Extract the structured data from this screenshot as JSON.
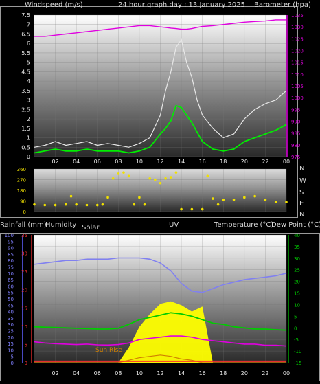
{
  "header": {
    "windspeed_label": "Windspeed (m/s)",
    "title": "24 hour graph day : 13 January 2025",
    "barometer_label": "Barometer (hpa)"
  },
  "legend_row": {
    "rainfall": "Rainfall (mm)",
    "humidity": "Humidity",
    "solar": "Solar",
    "uv": "UV",
    "temperature": "Temperature (°C)",
    "dew_point": "Dew Point (°C)"
  },
  "direction_labels": [
    "N",
    "W",
    "S",
    "E",
    "N"
  ],
  "sunrise_label": "Sun Rise",
  "colors": {
    "wind_gust": "#e8e8e8",
    "wind_avg": "#00ee00",
    "barometer": "#e000e0",
    "direction": "#f0e000",
    "humidity": "#8080f0",
    "temperature": "#00cc00",
    "dew_point": "#e000e0",
    "solar": "#ffff00",
    "uv": "#d08000",
    "rain": "#ff3030",
    "left_axis_humidity": "#6060ff",
    "right_axis_temp": "#00cc00"
  },
  "chart_data": [
    {
      "type": "line",
      "title": "24 hour graph day : 13 January 2025",
      "x_tick_labels": [
        "02",
        "04",
        "06",
        "08",
        "10",
        "12",
        "14",
        "16",
        "18",
        "20",
        "22",
        "00"
      ],
      "xlabel": "",
      "ylabel": "Windspeed (m/s)",
      "ylim": [
        0,
        7.5
      ],
      "y_ticks": [
        "0",
        "0.5",
        "1",
        "1.5",
        "2",
        "2.5",
        "3",
        "3.5",
        "4",
        "4.5",
        "5",
        "5.5",
        "6",
        "6.5",
        "7",
        "7.5"
      ],
      "y2label": "Barometer (hpa)",
      "y2lim": [
        975,
        1035
      ],
      "y2_ticks": [
        "975",
        "980",
        "985",
        "990",
        "995",
        "1000",
        "1005",
        "1010",
        "1015",
        "1020",
        "1025",
        "1030",
        "1035"
      ],
      "x_hours": [
        0,
        1,
        2,
        3,
        4,
        5,
        6,
        7,
        8,
        9,
        10,
        11,
        12,
        12.5,
        13,
        13.5,
        14,
        14.5,
        15,
        15.5,
        16,
        17,
        18,
        19,
        20,
        21,
        22,
        23,
        24
      ],
      "series": [
        {
          "values": [
            0.5,
            0.6,
            0.8,
            0.6,
            0.7,
            0.8,
            0.6,
            0.7,
            0.6,
            0.5,
            0.7,
            1.0,
            2.2,
            3.5,
            4.5,
            5.8,
            6.2,
            5.0,
            4.2,
            3.0,
            2.2,
            1.5,
            1.0,
            1.2,
            2.0,
            2.5,
            2.8,
            3.0,
            3.5
          ]
        },
        {
          "values": [
            0.2,
            0.3,
            0.4,
            0.3,
            0.3,
            0.4,
            0.3,
            0.3,
            0.3,
            0.2,
            0.3,
            0.5,
            1.2,
            1.5,
            1.9,
            2.7,
            2.6,
            2.2,
            1.8,
            1.3,
            0.8,
            0.4,
            0.3,
            0.4,
            0.8,
            1.0,
            1.2,
            1.4,
            1.7
          ]
        },
        {
          "axis": "y2",
          "values": [
            1026,
            1026,
            1026.5,
            1027,
            1027.5,
            1028,
            1028.5,
            1029,
            1029.5,
            1030,
            1030.5,
            1030.5,
            1030,
            1029.8,
            1029.5,
            1029.3,
            1029,
            1029,
            1029.3,
            1029.8,
            1030.2,
            1030.5,
            1031,
            1031.5,
            1032,
            1032.3,
            1032.5,
            1033,
            1033
          ]
        }
      ]
    },
    {
      "type": "scatter",
      "ylabel": "",
      "ylim": [
        0,
        360
      ],
      "y_ticks": [
        "0",
        "90",
        "180",
        "270",
        "360"
      ],
      "x_tick_labels": [],
      "x_hours": [
        0,
        1,
        2,
        3,
        3.5,
        4,
        5,
        6,
        6.5,
        7,
        7.5,
        8,
        8.5,
        9,
        9.5,
        10,
        10.5,
        11,
        11.5,
        12,
        12.5,
        13,
        13.5,
        14,
        15,
        16,
        16.5,
        17,
        17.5,
        18,
        19,
        20,
        21,
        22,
        23,
        24
      ],
      "series": [
        {
          "values": [
            60,
            55,
            55,
            60,
            130,
            60,
            55,
            55,
            60,
            120,
            280,
            320,
            330,
            300,
            60,
            120,
            60,
            280,
            270,
            240,
            280,
            290,
            330,
            20,
            20,
            20,
            300,
            110,
            60,
            100,
            100,
            120,
            130,
            100,
            80,
            80
          ]
        }
      ]
    },
    {
      "type": "line",
      "ylabel": "Humidity",
      "ylim": [
        0,
        100
      ],
      "y_ticks": [
        "0",
        "5",
        "10",
        "15",
        "20",
        "25",
        "30",
        "35",
        "40",
        "45",
        "50",
        "55",
        "60",
        "65",
        "70",
        "75",
        "80",
        "85",
        "90",
        "95",
        "100"
      ],
      "y_ticks_rain": [
        "0",
        "5",
        "10",
        "15",
        "20",
        "25",
        "30",
        "35"
      ],
      "y2label": "Temperature (°C)",
      "y2lim": [
        -15,
        40
      ],
      "y2_ticks": [
        "-15",
        "-10",
        "-5",
        "0",
        "5",
        "10",
        "15",
        "20",
        "25",
        "30",
        "35",
        "40"
      ],
      "x_tick_labels": [
        "02",
        "04",
        "06",
        "08",
        "10",
        "12",
        "14",
        "16",
        "18",
        "20",
        "22",
        "00"
      ],
      "x_hours": [
        0,
        1,
        2,
        3,
        4,
        5,
        6,
        7,
        8,
        9,
        10,
        11,
        12,
        13,
        14,
        15,
        16,
        17,
        18,
        19,
        20,
        21,
        22,
        23,
        24
      ],
      "series": [
        {
          "values": [
            77,
            78,
            79,
            80,
            80,
            81,
            81,
            81,
            82,
            82,
            82,
            81,
            78,
            72,
            62,
            56,
            55,
            58,
            61,
            63,
            65,
            66,
            67,
            68,
            70
          ]
        },
        {
          "axis": "y2",
          "values": [
            0.5,
            0.3,
            0.2,
            0,
            -0.2,
            -0.3,
            -0.5,
            -0.5,
            -0.2,
            1.5,
            3.5,
            4.5,
            5.5,
            6.5,
            6,
            5,
            3.5,
            2,
            1.5,
            0.5,
            0,
            -0.5,
            -0.5,
            -0.8,
            -1
          ]
        },
        {
          "axis": "y2",
          "values": [
            -6,
            -6.5,
            -6.8,
            -7,
            -7.2,
            -7,
            -7.3,
            -7.4,
            -7.2,
            -6.5,
            -5,
            -4.5,
            -4,
            -3.5,
            -3.5,
            -4,
            -5,
            -5.5,
            -6,
            -6.5,
            -7,
            -7,
            -7.5,
            -7.5,
            -7.8
          ]
        },
        {
          "values": [
            0,
            0,
            0,
            0,
            0,
            0,
            0,
            0,
            0,
            12,
            28,
            38,
            46,
            48,
            45,
            40,
            44,
            0,
            0,
            0,
            0,
            0,
            0,
            0,
            0
          ]
        },
        {
          "values": [
            0,
            0,
            0,
            0,
            0,
            0,
            0,
            0,
            0,
            2,
            4,
            5,
            6,
            5,
            3,
            2,
            0,
            0,
            0,
            0,
            0,
            0,
            0,
            0,
            0
          ]
        },
        {
          "values": [
            0.4,
            0.4,
            0.4,
            0.4,
            0.4,
            0.4,
            0.4,
            0.4,
            0.4,
            0.4,
            0.4,
            0.4,
            0.4,
            0.4,
            0.4,
            0.4,
            0.4,
            0.4,
            0.4,
            0.4,
            0.4,
            0.4,
            0.4,
            0.4,
            0.4
          ]
        }
      ]
    }
  ]
}
